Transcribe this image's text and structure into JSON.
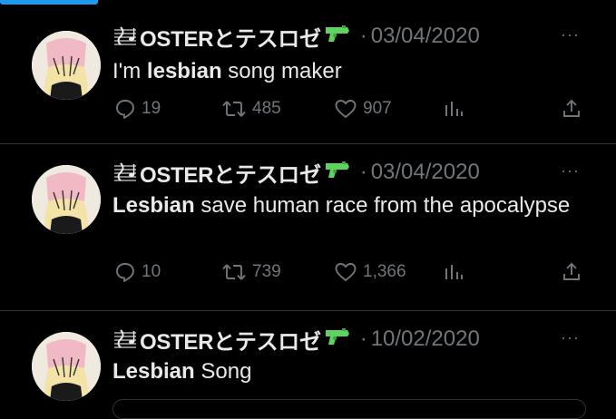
{
  "author": {
    "display_name": "OSTERとテスロゼ",
    "prefix_icon": "musical-score-icon",
    "suffix_icon": "water-pistol-icon"
  },
  "tweets": [
    {
      "date": "03/04/2020",
      "text_bold": "lesbian",
      "text_before": "I'm ",
      "text_after": " song maker",
      "replies": "19",
      "retweets": "485",
      "likes": "907"
    },
    {
      "date": "03/04/2020",
      "text_bold": "Lesbian",
      "text_before": "",
      "text_after": " save human race from the apocalypse",
      "replies": "10",
      "retweets": "739",
      "likes": "1,366"
    },
    {
      "date": "10/02/2020",
      "text_bold": "Lesbian",
      "text_before": "",
      "text_after": " Song"
    }
  ],
  "ui": {
    "separator": "·",
    "more": "···"
  },
  "colors": {
    "background": "#000000",
    "text": "#e7e9ea",
    "muted": "#71767b",
    "accent": "#1d9bf0",
    "divider": "#2f3336",
    "gun_green": "#5fd35f"
  }
}
